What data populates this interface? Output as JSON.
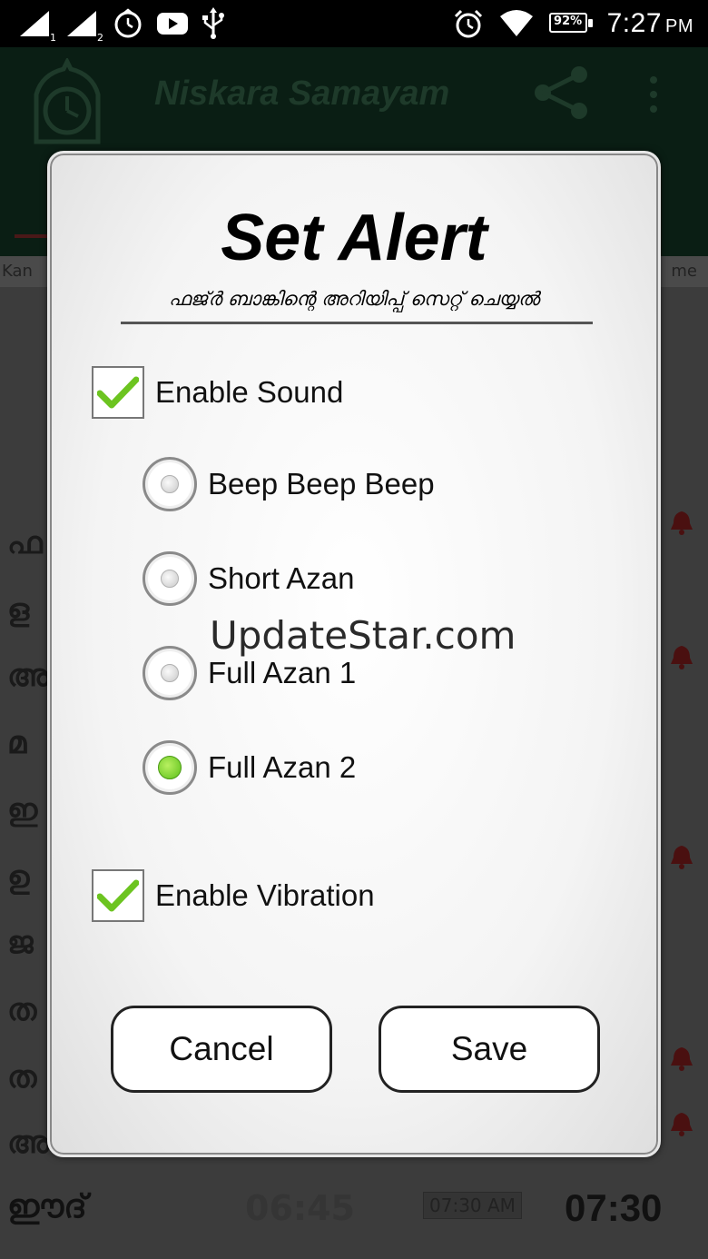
{
  "status_bar": {
    "sim1_label": "1",
    "sim2_label": "2",
    "battery": "92%",
    "time": "7:27",
    "ampm": "PM"
  },
  "app": {
    "title": "Niskara Samayam",
    "sub_left": "Kan",
    "sub_right": "me",
    "side_glyphs": [
      "ഫ",
      "ള",
      "അ",
      "മ",
      "ഇ",
      "ഉ",
      "ജ",
      "ത",
      "ത",
      "അ"
    ],
    "bottom_row": {
      "name": "ഈദ്",
      "time_faded": "06:45",
      "time_boxed": "07:30 AM",
      "time": "07:30"
    }
  },
  "dialog": {
    "title": "Set Alert",
    "subtitle": "ഫജ്ർ ബാങ്കിന്റെ അറിയിപ്പ് സെറ്റ് ചെയ്യൽ",
    "enable_sound": {
      "label": "Enable Sound",
      "checked": true
    },
    "sound_options": [
      {
        "label": "Beep Beep Beep",
        "selected": false
      },
      {
        "label": "Short Azan",
        "selected": false
      },
      {
        "label": "Full Azan 1",
        "selected": false
      },
      {
        "label": "Full Azan 2",
        "selected": true
      }
    ],
    "enable_vibration": {
      "label": "Enable Vibration",
      "checked": true
    },
    "cancel_label": "Cancel",
    "save_label": "Save"
  },
  "watermark": "UpdateStar.com",
  "colors": {
    "check_green": "#6cc420",
    "radio_selected": "#5cc01a",
    "app_bar": "#0a1e14"
  }
}
